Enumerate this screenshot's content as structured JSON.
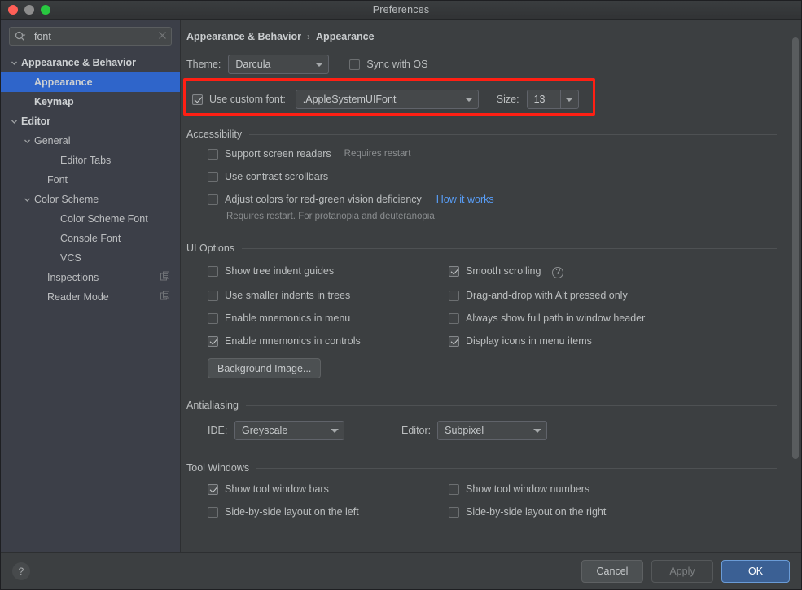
{
  "window": {
    "title": "Preferences",
    "traffic_lights": [
      "close-button",
      "minimize-button",
      "zoom-button"
    ]
  },
  "search": {
    "value": "font",
    "placeholder": "",
    "icon": "search-icon",
    "clear_icon": "close-icon"
  },
  "sidebar": {
    "items": [
      {
        "label": "Appearance & Behavior",
        "indent": 0,
        "arrow": "chevron-down",
        "bold": true,
        "selected": false,
        "badge": false
      },
      {
        "label": "Appearance",
        "indent": 1,
        "arrow": "none",
        "bold": true,
        "selected": true,
        "badge": false
      },
      {
        "label": "Keymap",
        "indent": 1,
        "arrow": "none",
        "bold": true,
        "selected": false,
        "badge": false
      },
      {
        "label": "Editor",
        "indent": 0,
        "arrow": "chevron-down",
        "bold": true,
        "selected": false,
        "badge": false
      },
      {
        "label": "General",
        "indent": 1,
        "arrow": "chevron-down",
        "bold": false,
        "selected": false,
        "badge": false
      },
      {
        "label": "Editor Tabs",
        "indent": 3,
        "arrow": "none",
        "bold": false,
        "selected": false,
        "badge": false
      },
      {
        "label": "Font",
        "indent": 2,
        "arrow": "none",
        "bold": false,
        "selected": false,
        "badge": false
      },
      {
        "label": "Color Scheme",
        "indent": 1,
        "arrow": "chevron-down",
        "bold": false,
        "selected": false,
        "badge": false
      },
      {
        "label": "Color Scheme Font",
        "indent": 3,
        "arrow": "none",
        "bold": false,
        "selected": false,
        "badge": false
      },
      {
        "label": "Console Font",
        "indent": 3,
        "arrow": "none",
        "bold": false,
        "selected": false,
        "badge": false
      },
      {
        "label": "VCS",
        "indent": 3,
        "arrow": "none",
        "bold": false,
        "selected": false,
        "badge": false
      },
      {
        "label": "Inspections",
        "indent": 2,
        "arrow": "none",
        "bold": false,
        "selected": false,
        "badge": true
      },
      {
        "label": "Reader Mode",
        "indent": 2,
        "arrow": "none",
        "bold": false,
        "selected": false,
        "badge": true
      }
    ]
  },
  "breadcrumb": {
    "parent": "Appearance & Behavior",
    "separator": "›",
    "current": "Appearance"
  },
  "theme_row": {
    "label": "Theme:",
    "value": "Darcula",
    "sync_label": "Sync with OS",
    "sync_checked": false
  },
  "custom_font_row": {
    "checkbox_label": "Use custom font:",
    "checked": true,
    "font_value": ".AppleSystemUIFont",
    "size_label": "Size:",
    "size_value": "13",
    "highlight_color": "#ff1f13"
  },
  "accessibility": {
    "title": "Accessibility",
    "items": [
      {
        "label": "Support screen readers",
        "checked": false,
        "hint": "Requires restart",
        "link": ""
      },
      {
        "label": "Use contrast scrollbars",
        "checked": false,
        "hint": "",
        "link": ""
      },
      {
        "label": "Adjust colors for red-green vision deficiency",
        "checked": false,
        "hint": "",
        "link": "How it works"
      }
    ],
    "note": "Requires restart. For protanopia and deuteranopia"
  },
  "ui_options": {
    "title": "UI Options",
    "left": [
      {
        "label": "Show tree indent guides",
        "checked": false,
        "help": false
      },
      {
        "label": "Use smaller indents in trees",
        "checked": false,
        "help": false
      },
      {
        "label": "Enable mnemonics in menu",
        "checked": false,
        "help": false
      },
      {
        "label": "Enable mnemonics in controls",
        "checked": true,
        "help": false
      }
    ],
    "right": [
      {
        "label": "Smooth scrolling",
        "checked": true,
        "help": true
      },
      {
        "label": "Drag-and-drop with Alt pressed only",
        "checked": false,
        "help": false
      },
      {
        "label": "Always show full path in window header",
        "checked": false,
        "help": false
      },
      {
        "label": "Display icons in menu items",
        "checked": true,
        "help": false
      }
    ],
    "background_image_button": "Background Image..."
  },
  "antialiasing": {
    "title": "Antialiasing",
    "ide_label": "IDE:",
    "ide_value": "Greyscale",
    "editor_label": "Editor:",
    "editor_value": "Subpixel"
  },
  "tool_windows": {
    "title": "Tool Windows",
    "left": [
      {
        "label": "Show tool window bars",
        "checked": true
      },
      {
        "label": "Side-by-side layout on the left",
        "checked": false
      }
    ],
    "right": [
      {
        "label": "Show tool window numbers",
        "checked": false
      },
      {
        "label": "Side-by-side layout on the right",
        "checked": false
      }
    ]
  },
  "footer": {
    "help": "?",
    "cancel": "Cancel",
    "apply": "Apply",
    "ok": "OK",
    "ok_color": "#3b6094"
  }
}
